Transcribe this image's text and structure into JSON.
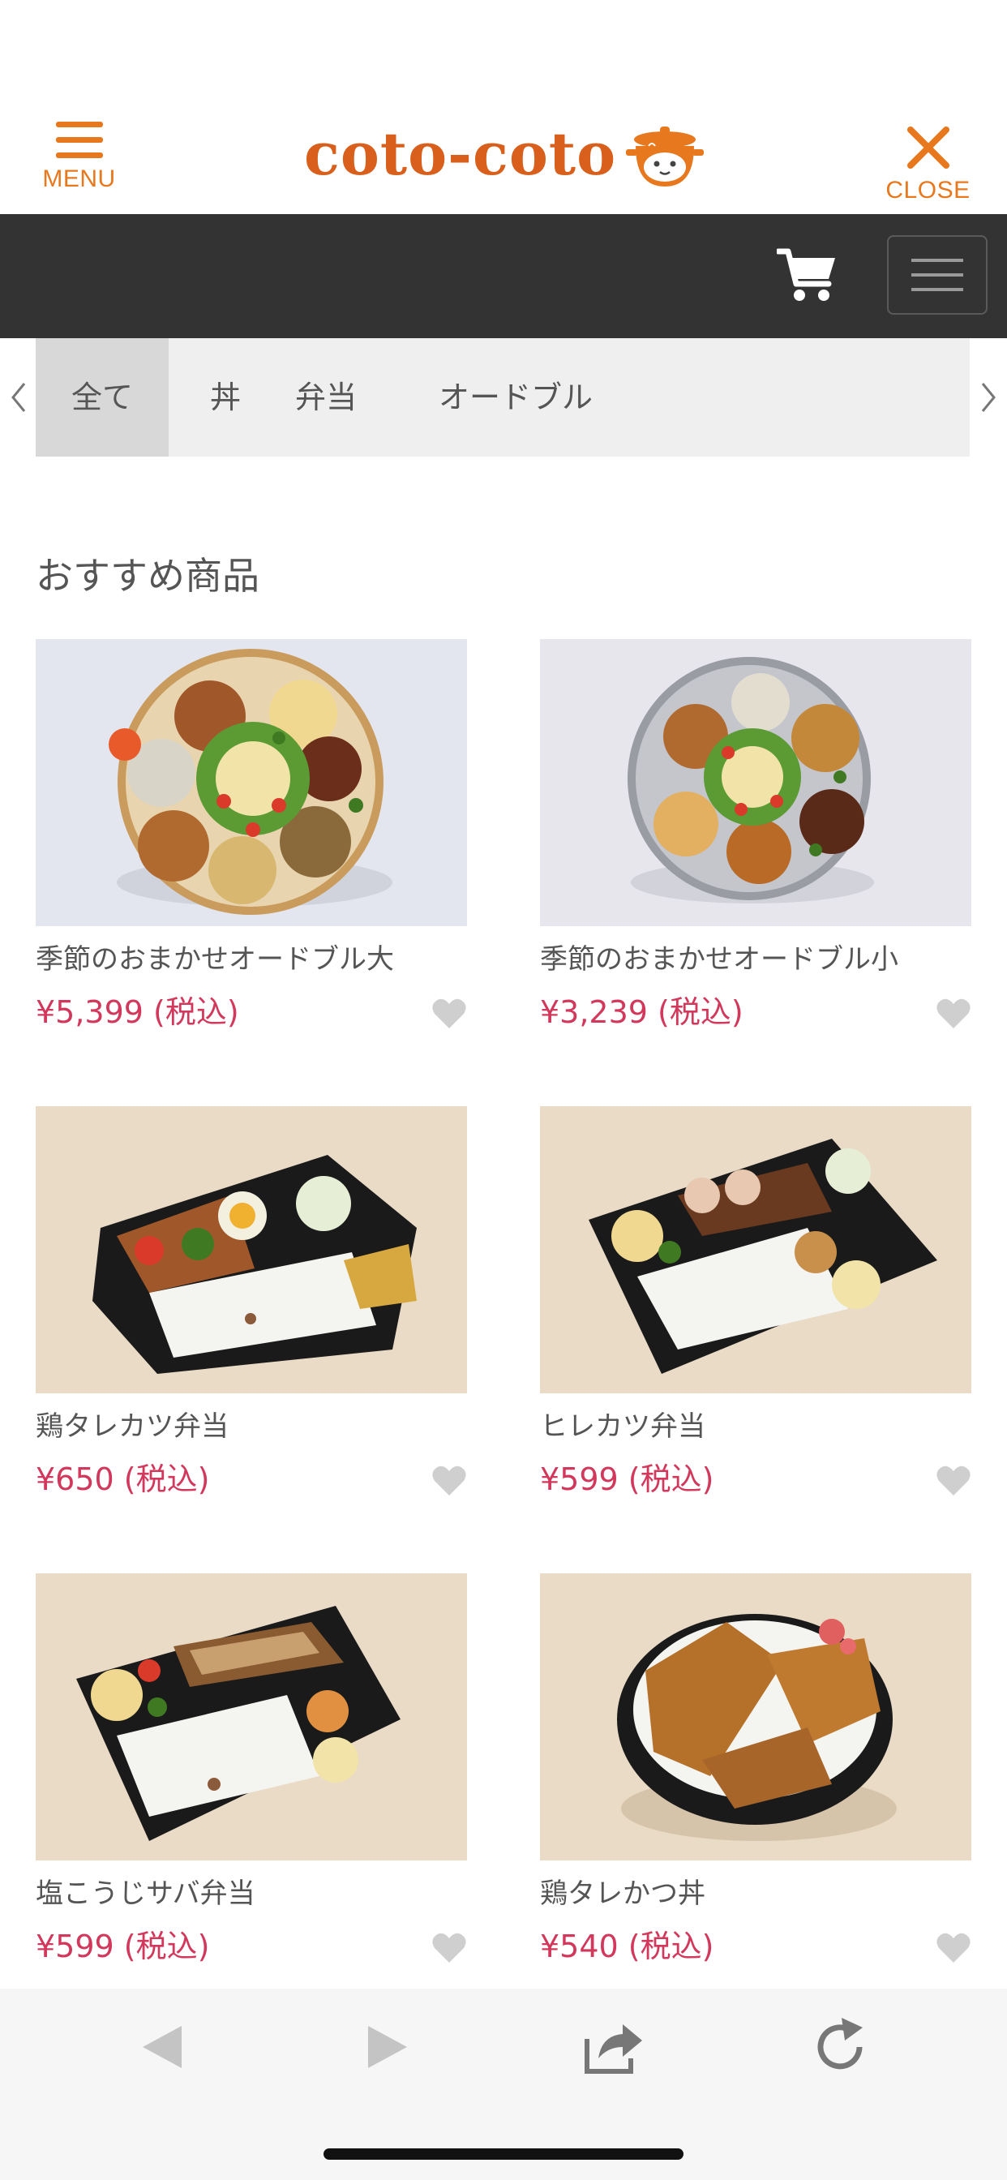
{
  "header": {
    "menu_label": "MENU",
    "close_label": "CLOSE",
    "logo_text": "coto-coto",
    "accent_color": "#e8781e"
  },
  "tabs": [
    {
      "label": "全て",
      "active": true
    },
    {
      "label": "丼",
      "active": false
    },
    {
      "label": "弁当",
      "active": false
    },
    {
      "label": "オードブル",
      "active": false
    }
  ],
  "section": {
    "title": "おすすめ商品"
  },
  "products": [
    {
      "name": "季節のおまかせオードブル大",
      "price": "¥5,399 (税込)"
    },
    {
      "name": "季節のおまかせオードブル小",
      "price": "¥3,239 (税込)"
    },
    {
      "name": "鶏タレカツ弁当",
      "price": "¥650 (税込)"
    },
    {
      "name": "ヒレカツ弁当",
      "price": "¥599 (税込)"
    },
    {
      "name": "塩こうじサバ弁当",
      "price": "¥599 (税込)"
    },
    {
      "name": "鶏タレかつ丼",
      "price": "¥540 (税込)"
    }
  ],
  "icons": {
    "menu": "hamburger-icon",
    "close": "close-icon",
    "cart": "cart-icon",
    "nav_toggle": "hamburger-icon",
    "favorite": "heart-icon",
    "back": "back-arrow-icon",
    "forward": "forward-arrow-icon",
    "share": "share-icon",
    "reload": "reload-icon"
  },
  "colors": {
    "price": "#d2385c",
    "nav_bar": "#333333",
    "logo": "#d9601c"
  }
}
